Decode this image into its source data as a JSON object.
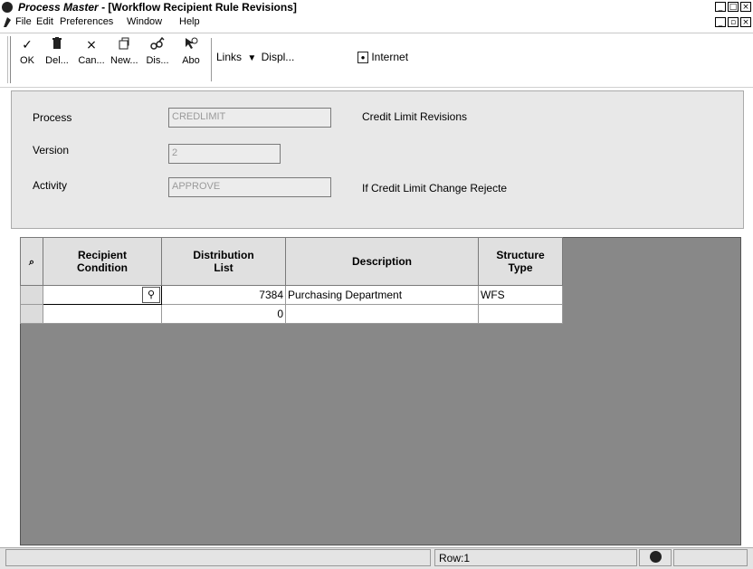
{
  "window": {
    "app_name": "Process Master",
    "title_rest": "- [Workflow Recipient Rule Revisions]",
    "controls": {
      "minimize": "_",
      "restore": "□",
      "close": "×"
    },
    "doc_controls": {
      "minimize": "_",
      "restore": "▫",
      "close": "×"
    }
  },
  "menu": [
    "File",
    "Edit",
    "Preferences",
    "Window",
    "Help"
  ],
  "toolbar": {
    "buttons": [
      {
        "icon": "checkmark-icon",
        "glyph": "✓",
        "label": "OK"
      },
      {
        "icon": "trash-icon",
        "glyph": "🗑",
        "label": "Del..."
      },
      {
        "icon": "cancel-x-icon",
        "glyph": "×",
        "label": "Can..."
      },
      {
        "icon": "new-document-icon",
        "glyph": "🗋",
        "label": "New..."
      },
      {
        "icon": "display-icon",
        "glyph": "⚯",
        "label": "Dis..."
      },
      {
        "icon": "about-help-icon",
        "glyph": "↖",
        "label": "Abo"
      }
    ],
    "links_label": "Links",
    "display_label": "Displ...",
    "internet_label": "Internet"
  },
  "header": {
    "process": {
      "label": "Process",
      "value": "CREDLIMIT",
      "description": "Credit Limit Revisions"
    },
    "version": {
      "label": "Version",
      "value": "2"
    },
    "activity": {
      "label": "Activity",
      "value": "APPROVE",
      "description": "If Credit Limit Change Rejecte"
    }
  },
  "grid": {
    "columns": [
      {
        "line1": "Recipient",
        "line2": "Condition"
      },
      {
        "line1": "Distribution",
        "line2": "List"
      },
      {
        "line1": "Description",
        "line2": ""
      },
      {
        "line1": "Structure",
        "line2": "Type"
      }
    ],
    "rows": [
      {
        "recipient_condition": "",
        "distribution_list": "7384",
        "description": "Purchasing Department",
        "structure_type": "WFS"
      },
      {
        "recipient_condition": "",
        "distribution_list": "0",
        "description": "",
        "structure_type": ""
      }
    ]
  },
  "status": {
    "row_text": "Row:1"
  }
}
